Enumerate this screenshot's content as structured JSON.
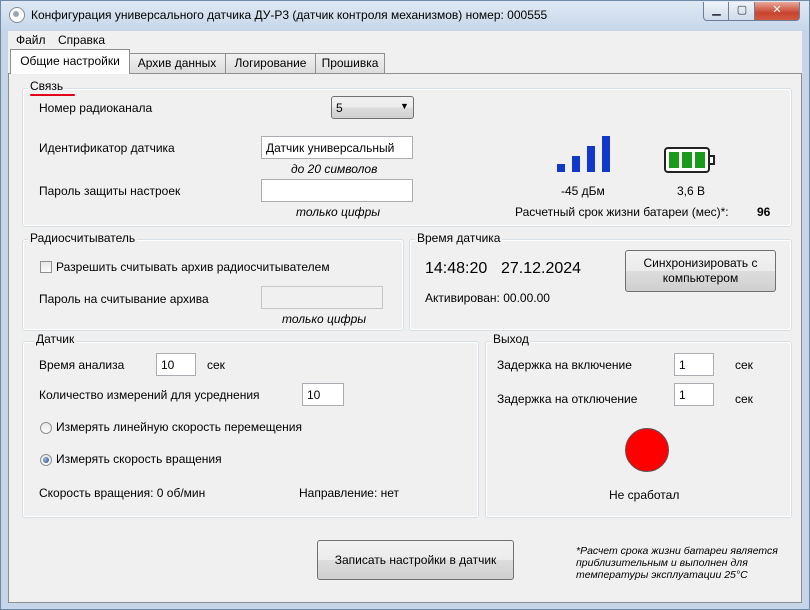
{
  "window": {
    "title": "Конфигурация универсального датчика ДУ-Р3 (датчик контроля механизмов) номер: 000555"
  },
  "menu": {
    "file": "Файл",
    "help": "Справка"
  },
  "tabs": [
    "Общие настройки",
    "Архив данных",
    "Логирование",
    "Прошивка"
  ],
  "active_tab": 0,
  "link_group": {
    "title": "Связь",
    "radio_channel_label": "Номер радиоканала",
    "radio_channel_value": "5",
    "sensor_id_label": "Идентификатор датчика",
    "sensor_id_value": "Датчик универсальный",
    "sensor_id_hint": "до 20 символов",
    "password_label": "Пароль защиты настроек",
    "password_value": "",
    "password_hint": "только цифры",
    "signal_level": "-45 дБм",
    "signal_bars": 4,
    "battery_voltage": "3,6 В",
    "battery_level": 3,
    "battery_life_label": "Расчетный срок жизни батареи (мес)*:",
    "battery_life_value": "96",
    "colors": {
      "signal": "#1238c9",
      "battery": "#1a9a1a"
    }
  },
  "reader_group": {
    "title": "Радиосчитыватель",
    "allow_label": "Разрешить считывать архив радиосчитывателем",
    "allow_checked": false,
    "password_label": "Пароль на считывание архива",
    "password_value": "",
    "password_hint": "только цифры"
  },
  "time_group": {
    "title": "Время датчика",
    "time": "14:48:20",
    "date": "27.12.2024",
    "sync_button": "Синхронизировать с компьютером",
    "activated": "Активирован: 00.00.00"
  },
  "sensor_group": {
    "title": "Датчик",
    "analysis_label": "Время анализа",
    "analysis_value": "10",
    "analysis_unit": "сек",
    "count_label": "Количество измерений для усреднения",
    "count_value": "10",
    "radio_linear": "Измерять линейную скорость перемещения",
    "radio_rotation": "Измерять скорость вращения",
    "selected_mode": "rotation",
    "rotation_speed": "Скорость вращения: 0 об/мин",
    "direction": "Направление: нет"
  },
  "output_group": {
    "title": "Выход",
    "on_delay_label": "Задержка на включение",
    "on_delay_value": "1",
    "on_delay_unit": "сек",
    "off_delay_label": "Задержка на отключение",
    "off_delay_value": "1",
    "off_delay_unit": "сек",
    "indicator_color": "#ff0000",
    "status": "Не сработал"
  },
  "footer": {
    "write_button": "Записать настройки в датчик",
    "note": "*Расчет срока жизни батареи является приблизительным и выполнен для температуры эксплуатации 25°С"
  }
}
